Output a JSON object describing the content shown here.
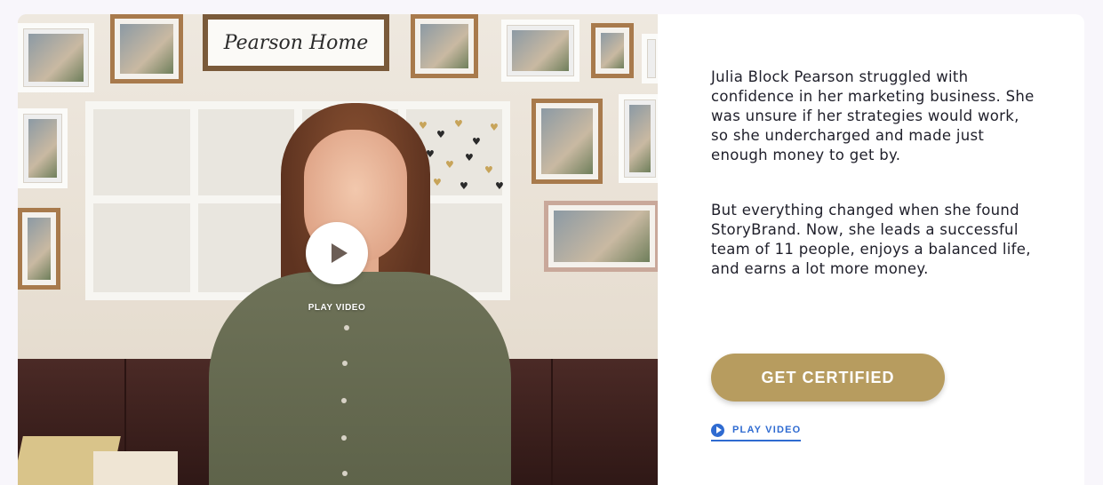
{
  "video": {
    "sign_text": "Pearson Home",
    "play_label": "PLAY VIDEO",
    "play_icon": "play-icon"
  },
  "copy": {
    "paragraph_1": "Julia Block Pearson struggled with confidence in her marketing business. She was unsure if her strategies would work, so she undercharged and made just enough money to get by.",
    "paragraph_2": "But everything changed when she found StoryBrand. Now, she leads a successful team of 11 people, enjoys a balanced life, and earns a lot more money."
  },
  "cta": {
    "label": "GET CERTIFIED"
  },
  "play_link": {
    "label": "PLAY VIDEO",
    "icon": "play-circle-icon"
  },
  "colors": {
    "cta_background": "#b79c5f",
    "link_blue": "#2f6bd1",
    "page_background": "#f8f6fb"
  }
}
